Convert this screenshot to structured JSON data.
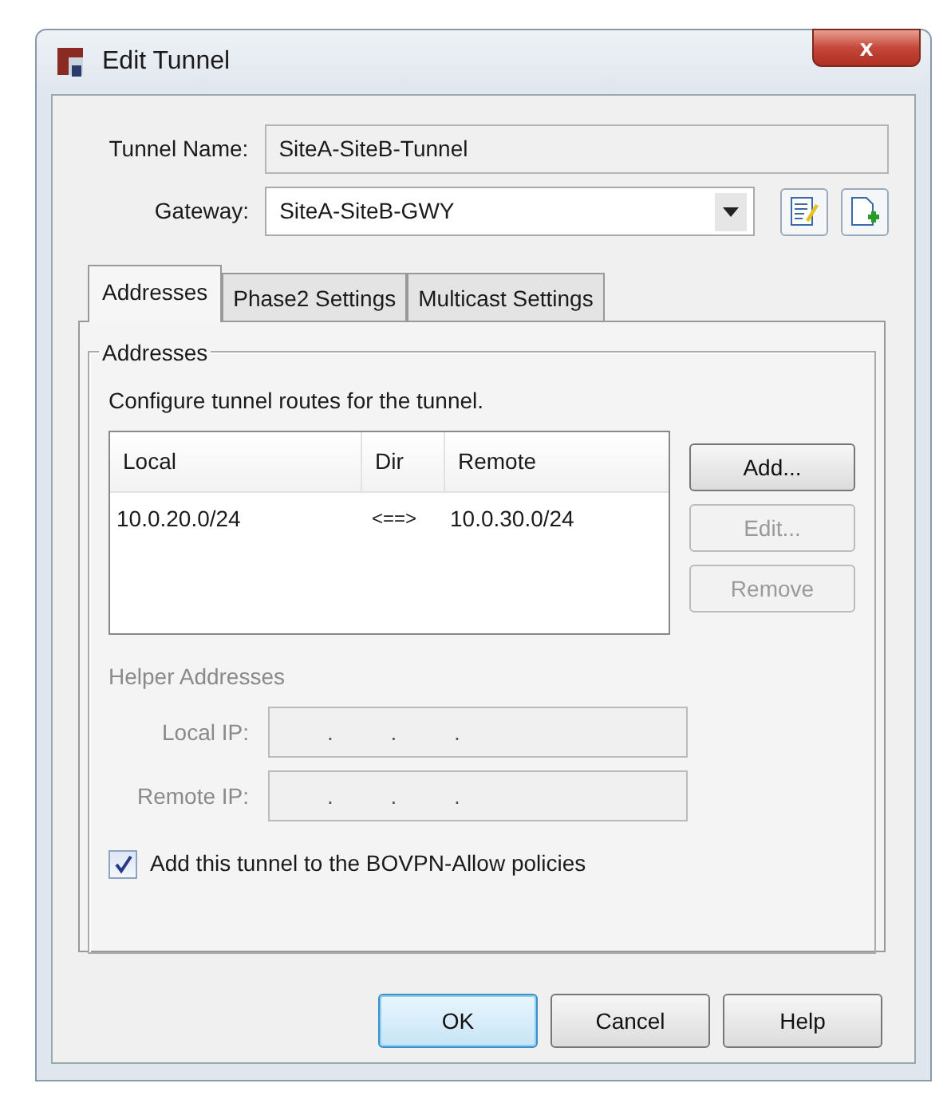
{
  "window": {
    "title": "Edit Tunnel",
    "close": "x"
  },
  "tunnel_name": {
    "label": "Tunnel Name:",
    "value": "SiteA-SiteB-Tunnel"
  },
  "gateway": {
    "label": "Gateway:",
    "value": "SiteA-SiteB-GWY"
  },
  "tabs": [
    {
      "label": "Addresses",
      "selected": true
    },
    {
      "label": "Phase2 Settings",
      "selected": false
    },
    {
      "label": "Multicast Settings",
      "selected": false
    }
  ],
  "addresses": {
    "legend": "Addresses",
    "description": "Configure tunnel routes for the tunnel.",
    "table": {
      "columns": [
        "Local",
        "Dir",
        "Remote"
      ],
      "rows": [
        [
          "10.0.20.0/24",
          "<==>",
          "10.0.30.0/24"
        ]
      ]
    },
    "buttons": [
      {
        "label": "Add...",
        "disabled": false
      },
      {
        "label": "Edit...",
        "disabled": true
      },
      {
        "label": "Remove",
        "disabled": true
      }
    ],
    "helper": {
      "title": "Helper Addresses",
      "disabled": true,
      "fields": [
        {
          "label": "Local IP:",
          "value": ". . ."
        },
        {
          "label": "Remote IP:",
          "value": ". . ."
        }
      ]
    },
    "allow_policies": {
      "label": "Add this tunnel to the BOVPN-Allow policies",
      "checked": true
    }
  },
  "buttons": [
    {
      "label": "OK",
      "default": true
    },
    {
      "label": "Cancel",
      "default": false
    },
    {
      "label": "Help",
      "default": false
    }
  ]
}
